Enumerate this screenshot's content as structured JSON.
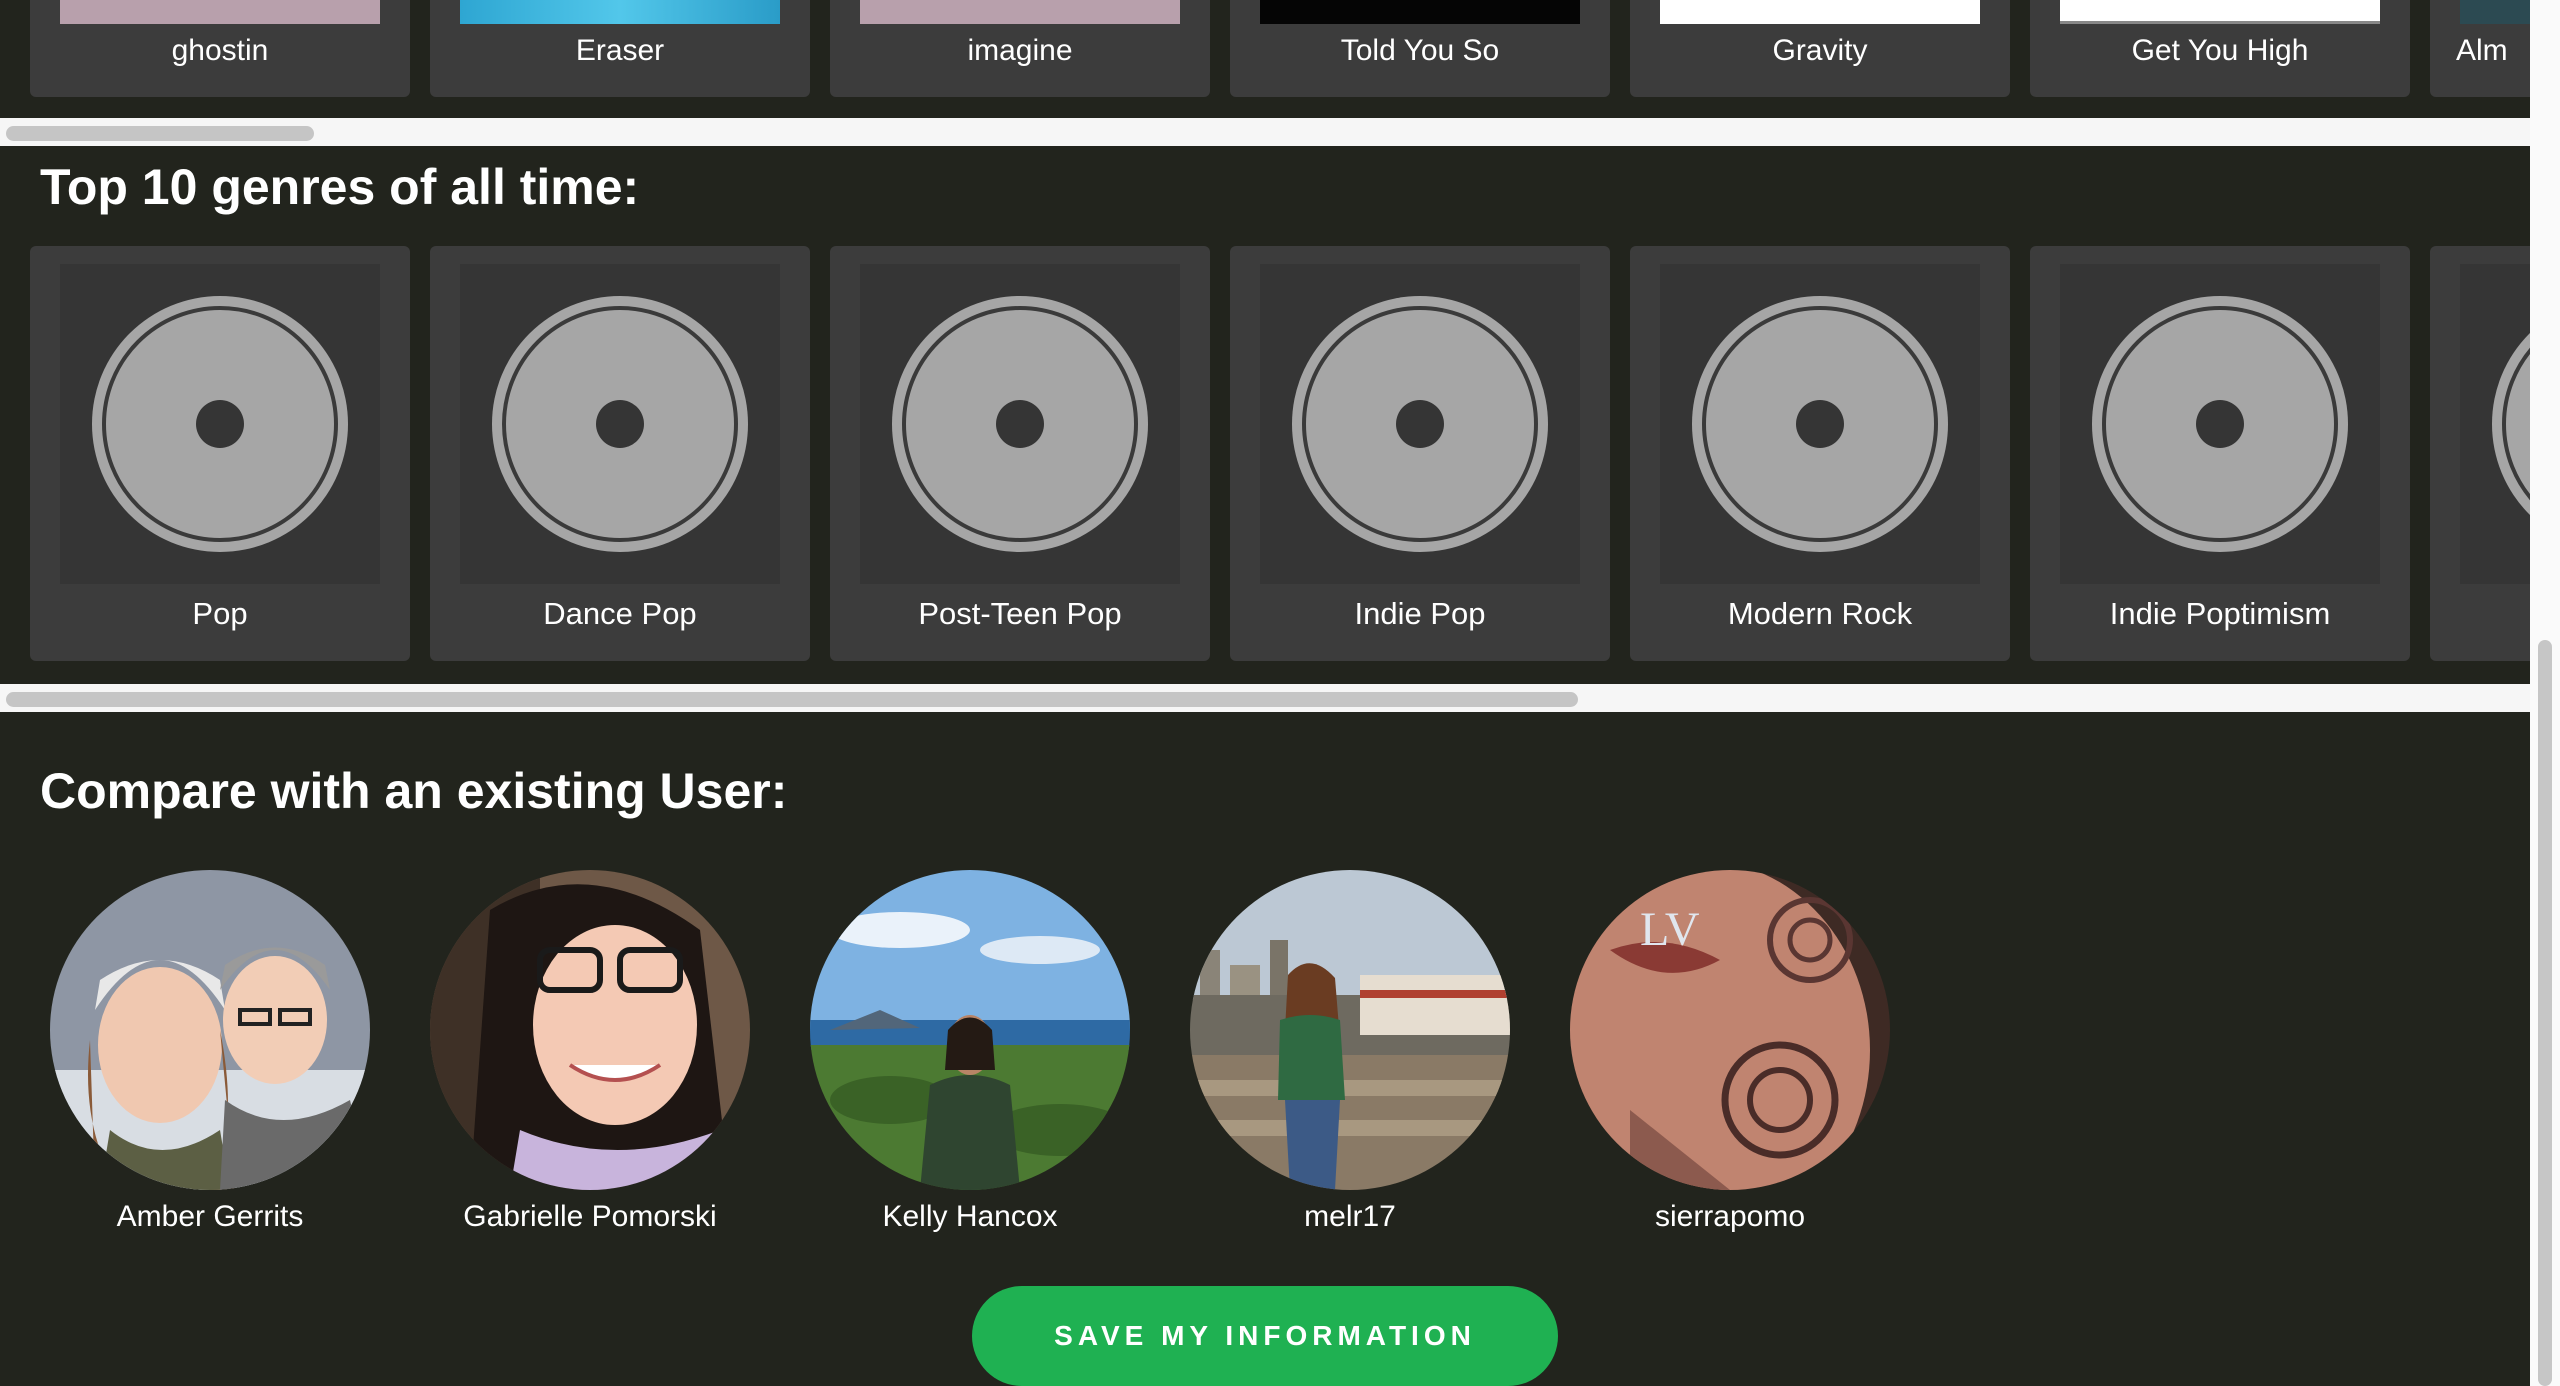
{
  "tracks": [
    {
      "name": "ghostin",
      "thumb_color": "#b8a0ac"
    },
    {
      "name": "Eraser",
      "thumb_color": "#3ab2d8"
    },
    {
      "name": "imagine",
      "thumb_color": "#b8a0ac"
    },
    {
      "name": "Told You So",
      "thumb_color": "#050505"
    },
    {
      "name": "Gravity",
      "thumb_color": "#ffffff"
    },
    {
      "name": "Get You High",
      "thumb_color": "#ffffff"
    },
    {
      "name": "Alm",
      "thumb_color": "#2c4a52"
    }
  ],
  "genres_heading": "Top 10 genres of all time:",
  "genres": [
    {
      "label": "Pop"
    },
    {
      "label": "Dance Pop"
    },
    {
      "label": "Post-Teen Pop"
    },
    {
      "label": "Indie Pop"
    },
    {
      "label": "Modern Rock"
    },
    {
      "label": "Indie Poptimism"
    },
    {
      "label": ""
    }
  ],
  "compare_heading": "Compare with an existing User:",
  "users": [
    {
      "name": "Amber Gerrits"
    },
    {
      "name": "Gabrielle Pomorski"
    },
    {
      "name": "Kelly Hancox"
    },
    {
      "name": "melr17"
    },
    {
      "name": "sierrapomo"
    }
  ],
  "save_button": "SAVE MY INFORMATION",
  "colors": {
    "background": "#22241d",
    "card": "#3c3c3c",
    "accent_green": "#1fb152",
    "disc_gray": "#a6a6a6"
  }
}
